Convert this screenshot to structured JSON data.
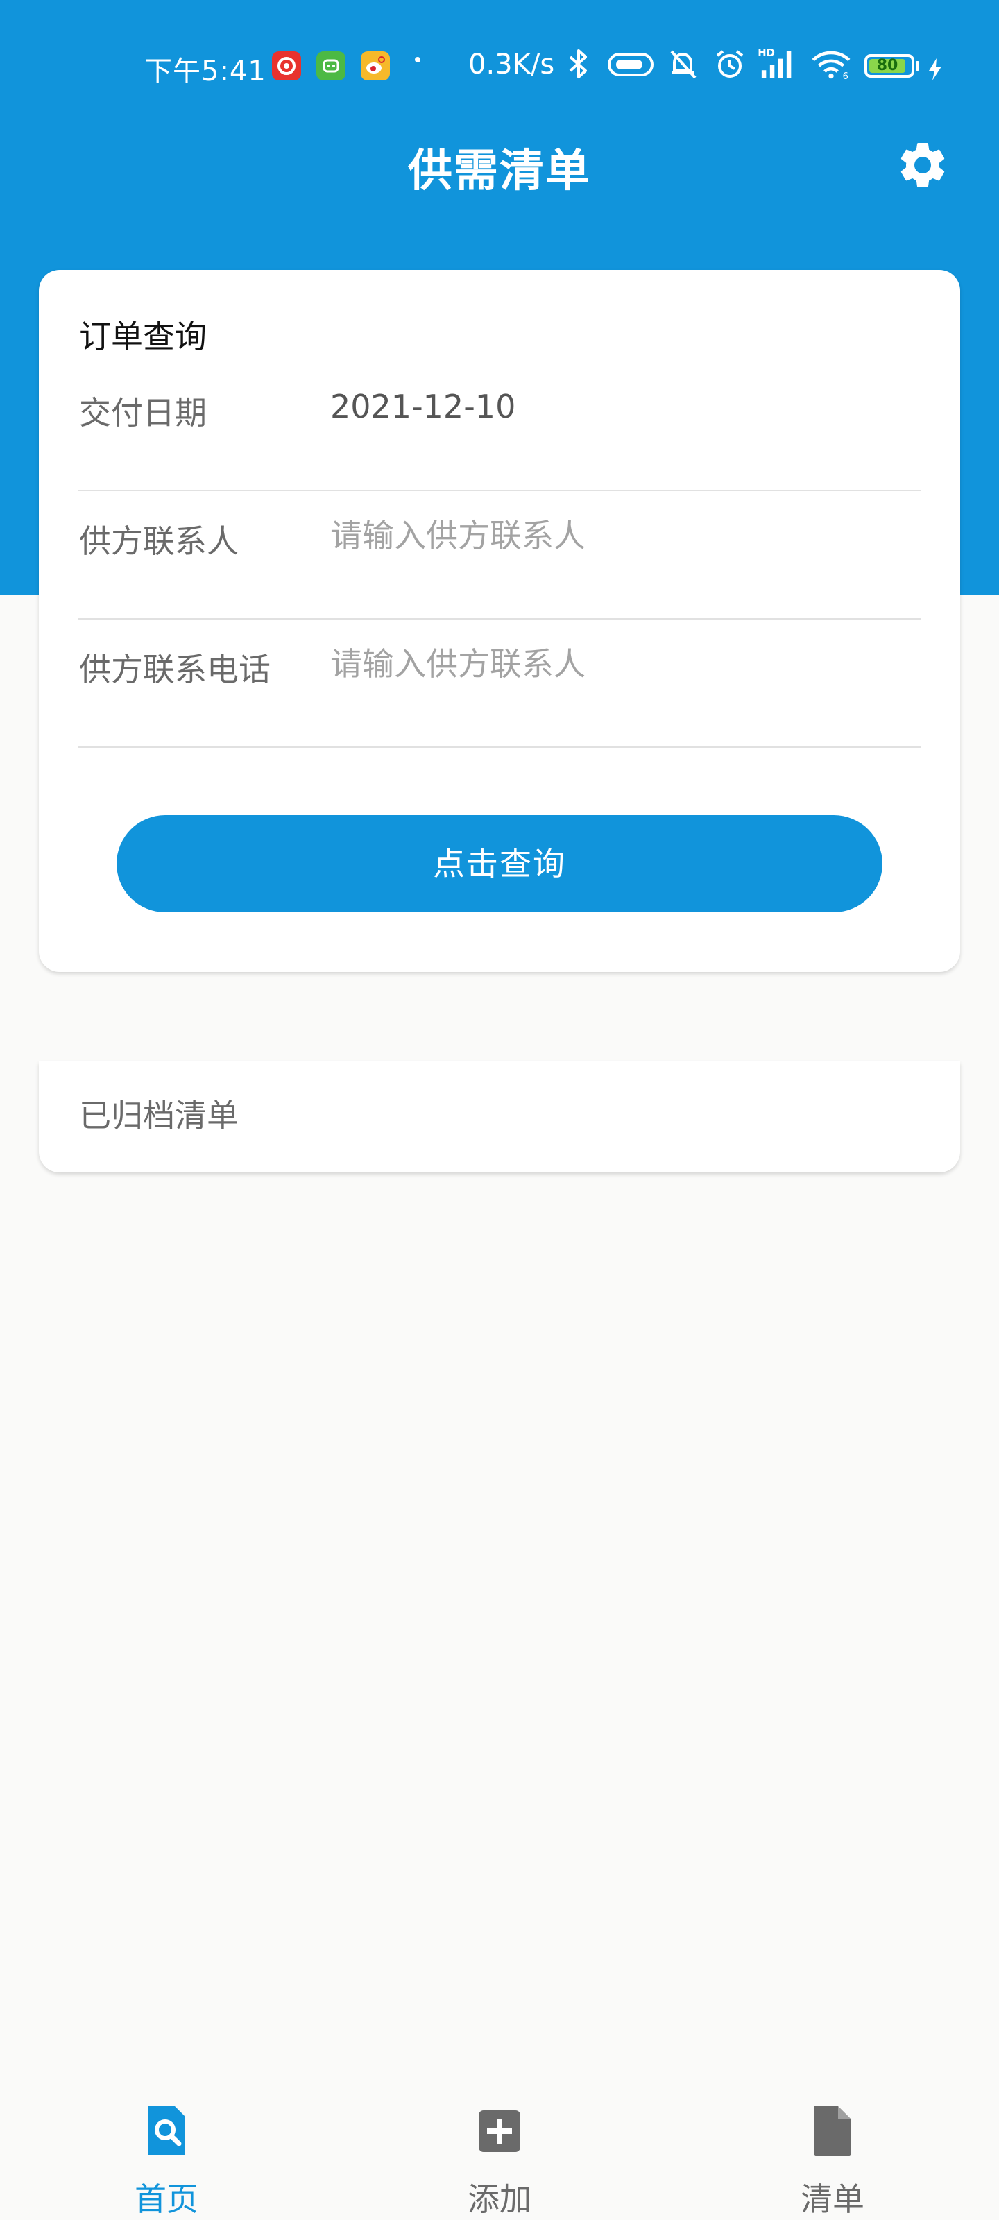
{
  "status_bar": {
    "time": "下午5:41",
    "net_speed": "0.3K/s",
    "battery_level": "80",
    "icons": [
      "netease-music-icon",
      "wechat-mini-icon",
      "weibo-icon",
      "bluetooth-icon",
      "nfc-icon",
      "mute-bell-icon",
      "alarm-icon",
      "hd-signal-icon",
      "wifi-icon",
      "battery-icon",
      "charging-icon"
    ]
  },
  "header": {
    "title": "供需清单",
    "settings_icon": "gear-icon"
  },
  "query_card": {
    "title": "订单查询",
    "fields": [
      {
        "label": "交付日期",
        "value": "2021-12-10"
      },
      {
        "label": "供方联系人",
        "placeholder": "请输入供方联系人"
      },
      {
        "label": "供方联系电话",
        "placeholder": "请输入供方联系人"
      }
    ],
    "submit_label": "点击查询"
  },
  "archived_card": {
    "label": "已归档清单"
  },
  "tabs": [
    {
      "label": "首页",
      "icon": "search-doc-icon",
      "active": true
    },
    {
      "label": "添加",
      "icon": "plus-box-icon",
      "active": false
    },
    {
      "label": "清单",
      "icon": "document-icon",
      "active": false
    }
  ],
  "colors": {
    "primary": "#1194db",
    "background": "#fafaf9",
    "inactive_tab": "#6a6a6a"
  }
}
